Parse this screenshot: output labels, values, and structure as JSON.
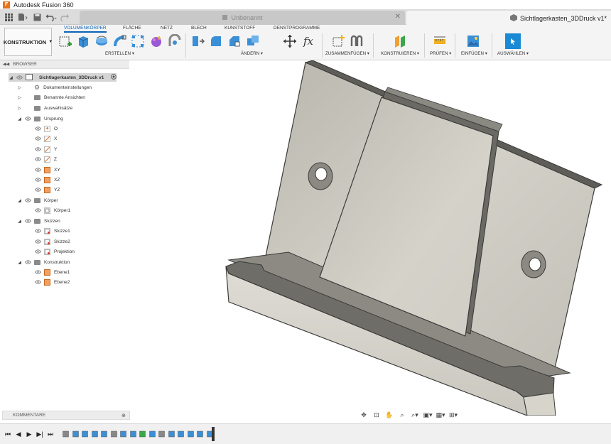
{
  "window": {
    "title": "Autodesk Fusion 360",
    "logo_letter": "F"
  },
  "quick_access": {
    "grid_icon": "grid-icon",
    "file_icon": "file-icon",
    "save_icon": "save-icon",
    "undo_icon": "undo-icon",
    "redo_icon": "redo-icon"
  },
  "tabs": {
    "inactive_label": "Unbenannt",
    "active_label": "Sichtlagerkasten_3DDruck v1*"
  },
  "ribbon": {
    "workspace": "KONSTRUKTION",
    "tabs": [
      "VOLUMENKÖRPER",
      "FLÄCHE",
      "NETZ",
      "BLECH",
      "KUNSTSTOFF",
      "DENSTPROGRAMME"
    ],
    "groups": [
      "ERSTELLEN",
      "ÄNDERN",
      "ZUSAMMENFÜGEN",
      "KONSTRUIEREN",
      "PRÜFEN",
      "EINFÜGEN",
      "AUSWÄHLEN"
    ]
  },
  "browser": {
    "title": "BROWSER",
    "rows": [
      {
        "label": "Sichtlagerkasten_3DDruck v1",
        "selected": true
      },
      {
        "label": "Dokumenteinstellungen"
      },
      {
        "label": "Benannte Ansichten"
      },
      {
        "label": "Auswahlsätze"
      },
      {
        "label": "Ursprung"
      },
      {
        "label": "O"
      },
      {
        "label": "X"
      },
      {
        "label": "Y"
      },
      {
        "label": "Z"
      },
      {
        "label": "XY"
      },
      {
        "label": "XZ"
      },
      {
        "label": "YZ"
      },
      {
        "label": "Körper"
      },
      {
        "label": "Körper1"
      },
      {
        "label": "Skizzen"
      },
      {
        "label": "Skizze1"
      },
      {
        "label": "Skizze2"
      },
      {
        "label": "Projektion"
      },
      {
        "label": "Konstruktion"
      },
      {
        "label": "Ebene1"
      },
      {
        "label": "Ebene2"
      }
    ]
  },
  "comments": {
    "label": "KOMMENTARE"
  },
  "colors": {
    "accent": "#0a64b8",
    "model_face": "#c8c6bd",
    "model_edge": "#3a3a3a",
    "model_dark": "#6b6a64"
  }
}
